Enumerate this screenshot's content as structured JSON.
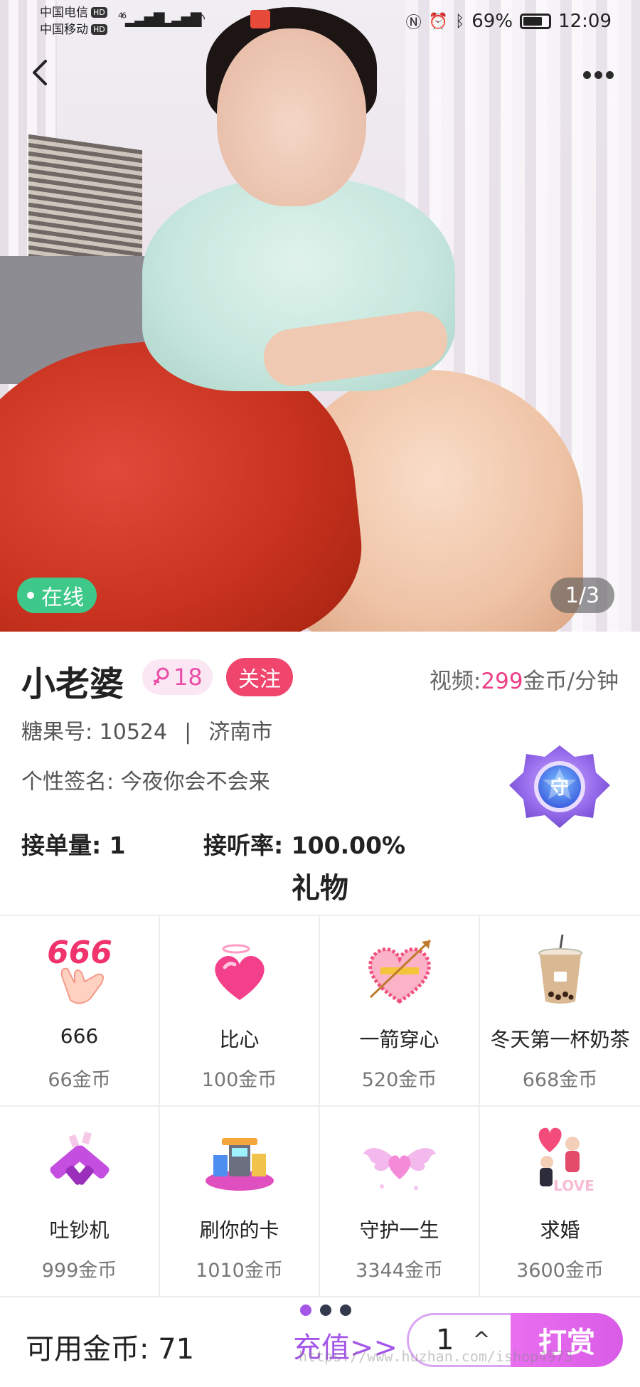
{
  "status_bar": {
    "carrier1": "中国电信",
    "carrier2": "中国移动",
    "hd": "HD",
    "network": "46",
    "battery": "69%",
    "time": "12:09"
  },
  "photo": {
    "online_label": "在线",
    "pager": "1/3"
  },
  "profile": {
    "name": "小老婆",
    "age": "18",
    "follow_label": "关注",
    "price_prefix": "视频:",
    "price_value": "299",
    "price_suffix": "金币/分钟",
    "id_label": "糖果号: 10524",
    "separator": "|",
    "city": "济南市",
    "signature": "个性签名: 今夜你会不会来",
    "badge_text": "守",
    "orders": "接单量: 1",
    "answer_rate": "接听率: 100.00%"
  },
  "gifts": {
    "title": "礼物",
    "items": [
      {
        "name": "666",
        "price": "66金币",
        "icon": "hand-666-icon"
      },
      {
        "name": "比心",
        "price": "100金币",
        "icon": "heart-icon"
      },
      {
        "name": "一箭穿心",
        "price": "520金币",
        "icon": "arrow-heart-icon"
      },
      {
        "name": "冬天第一杯奶茶",
        "price": "668金币",
        "icon": "milk-tea-icon"
      },
      {
        "name": "吐钞机",
        "price": "999金币",
        "icon": "money-gun-icon"
      },
      {
        "name": "刷你的卡",
        "price": "1010金币",
        "icon": "shopping-icon"
      },
      {
        "name": "守护一生",
        "price": "3344金币",
        "icon": "wings-heart-icon"
      },
      {
        "name": "求婚",
        "price": "3600金币",
        "icon": "proposal-icon"
      }
    ]
  },
  "bottom": {
    "balance": "可用金币: 71",
    "recharge": "充值>>",
    "quantity": "1",
    "caret": "^",
    "reward": "打赏",
    "watermark": "https://www.huzhan.com/ishop4973"
  },
  "colors": {
    "accent_pink": "#f0456d",
    "purple": "#a356e8",
    "online_green": "#3ec98a"
  }
}
